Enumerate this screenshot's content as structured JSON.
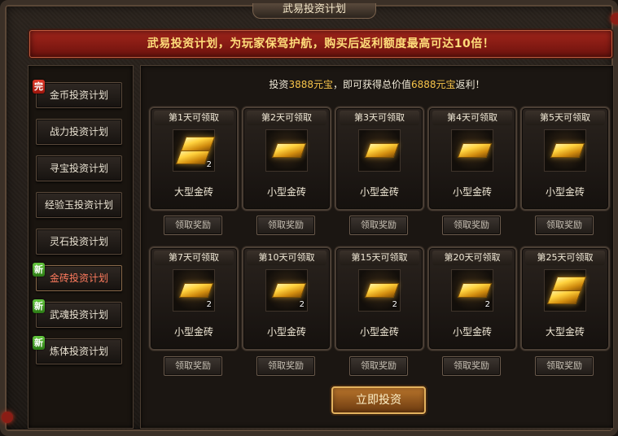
{
  "window": {
    "title": "武易投资计划"
  },
  "banner": {
    "text": "武易投资计划，为玩家保驾护航，购买后返利额度最高可达10倍！"
  },
  "sidebar": {
    "items": [
      {
        "label": "金币投资计划",
        "badge": "完",
        "badge_color": "#c8241a",
        "active": false
      },
      {
        "label": "战力投资计划",
        "badge": "",
        "active": false
      },
      {
        "label": "寻宝投资计划",
        "badge": "",
        "active": false
      },
      {
        "label": "经验玉投资计划",
        "badge": "",
        "active": false
      },
      {
        "label": "灵石投资计划",
        "badge": "",
        "active": false
      },
      {
        "label": "金砖投资计划",
        "badge": "新",
        "badge_color": "#3e9a1f",
        "active": true
      },
      {
        "label": "武魂投资计划",
        "badge": "新",
        "badge_color": "#3e9a1f",
        "active": false
      },
      {
        "label": "炼体投资计划",
        "badge": "新",
        "badge_color": "#3e9a1f",
        "active": false
      }
    ]
  },
  "main": {
    "invest_prefix": "投资",
    "invest_amount": "3888元宝",
    "invest_middle": "，即可获得总价值",
    "invest_total": "6888元宝",
    "invest_suffix": "返利！",
    "claim_label": "领取奖励",
    "invest_button": "立即投资",
    "rewards": [
      {
        "day": "第1天可领取",
        "item": "大型金砖",
        "qty": "2",
        "icon": "large-gold-brick-icon"
      },
      {
        "day": "第2天可领取",
        "item": "小型金砖",
        "qty": "",
        "icon": "small-gold-brick-icon"
      },
      {
        "day": "第3天可领取",
        "item": "小型金砖",
        "qty": "",
        "icon": "small-gold-brick-icon"
      },
      {
        "day": "第4天可领取",
        "item": "小型金砖",
        "qty": "",
        "icon": "small-gold-brick-icon"
      },
      {
        "day": "第5天可领取",
        "item": "小型金砖",
        "qty": "",
        "icon": "small-gold-brick-icon"
      },
      {
        "day": "第7天可领取",
        "item": "小型金砖",
        "qty": "2",
        "icon": "small-gold-brick-icon"
      },
      {
        "day": "第10天可领取",
        "item": "小型金砖",
        "qty": "2",
        "icon": "small-gold-brick-icon"
      },
      {
        "day": "第15天可领取",
        "item": "小型金砖",
        "qty": "2",
        "icon": "small-gold-brick-icon"
      },
      {
        "day": "第20天可领取",
        "item": "小型金砖",
        "qty": "2",
        "icon": "small-gold-brick-icon"
      },
      {
        "day": "第25天可领取",
        "item": "大型金砖",
        "qty": "",
        "icon": "large-gold-brick-icon"
      }
    ]
  },
  "colors": {
    "accent_gold": "#f7c44a",
    "banner_red": "#a2251b",
    "active_text": "#ff7b5e"
  }
}
